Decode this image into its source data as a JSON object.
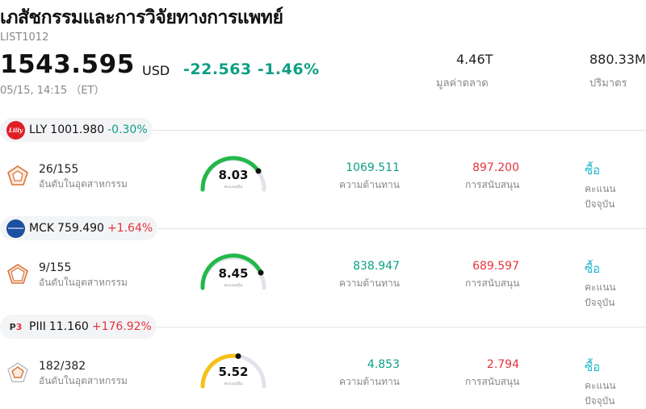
{
  "header": {
    "title": "เภสัชกรรมและการวิจัยทางการแพทย์",
    "code": "LIST1012",
    "price": "1543.595",
    "currency": "USD",
    "change": "-22.563 -1.46%",
    "time": "05/15, 14:15 （ET）",
    "market_cap_value": "4.46T",
    "market_cap_label": "มูลค่าตลาด",
    "volume_value": "880.33M",
    "volume_label": "ปริมาตร"
  },
  "colors": {
    "up": "#e3343f",
    "down": "#0e9f84",
    "accent": "#1fb5c8",
    "gauge_green": "#22b84a",
    "gauge_yellow": "#f5c118"
  },
  "stocks": [
    {
      "ticker": "LLY",
      "price": "1001.980",
      "change": "-0.30%",
      "logo_text": "Lilly",
      "rank": "26/155",
      "rank_label": "อันดับในอุตสาหกรรม",
      "score": "8.03",
      "score_label": "คะแนนหุ้น",
      "resistance": "1069.511",
      "resistance_label": "ความต้านทาน",
      "support": "897.200",
      "support_label": "การสนับสนุน",
      "action": "ซื้อ",
      "action_label": "คะแนนปัจจุบัน"
    },
    {
      "ticker": "MCK",
      "price": "759.490",
      "change": "+1.64%",
      "logo_text": "MCKESSON",
      "rank": "9/155",
      "rank_label": "อันดับในอุตสาหกรรม",
      "score": "8.45",
      "score_label": "คะแนนหุ้น",
      "resistance": "838.947",
      "resistance_label": "ความต้านทาน",
      "support": "689.597",
      "support_label": "การสนับสนุน",
      "action": "ซื้อ",
      "action_label": "คะแนนปัจจุบัน"
    },
    {
      "ticker": "PIII",
      "price": "11.160",
      "change": "+176.92%",
      "logo_text": "P3",
      "rank": "182/382",
      "rank_label": "อันดับในอุตสาหกรรม",
      "score": "5.52",
      "score_label": "คะแนนหุ้น",
      "resistance": "4.853",
      "resistance_label": "ความต้านทาน",
      "support": "2.794",
      "support_label": "การสนับสนุน",
      "action": "ซื้อ",
      "action_label": "คะแนนปัจจุบัน"
    }
  ]
}
